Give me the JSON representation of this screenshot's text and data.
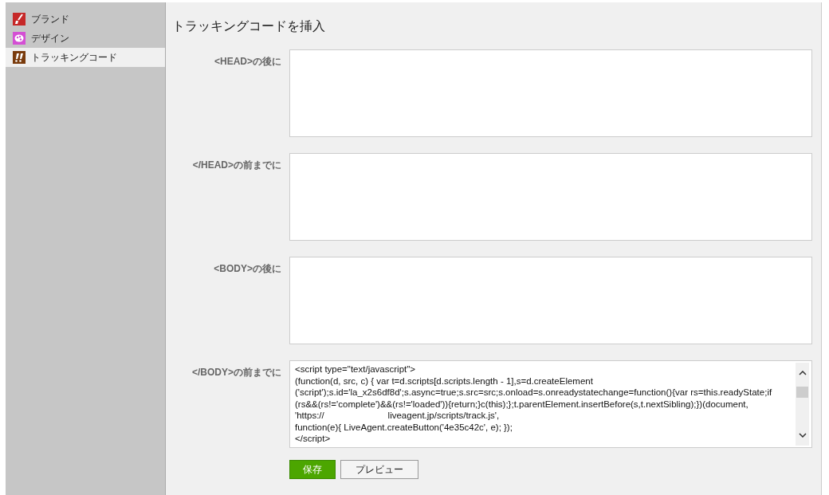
{
  "sidebar": {
    "items": [
      {
        "label": "ブランド",
        "kind": "brand",
        "selected": false
      },
      {
        "label": "デザイン",
        "kind": "design",
        "selected": false
      },
      {
        "label": "トラッキングコード",
        "kind": "tracking",
        "selected": true
      }
    ]
  },
  "main": {
    "title": "トラッキングコードを挿入",
    "fields": [
      {
        "label": "<HEAD>の後に"
      },
      {
        "label": "</HEAD>の前までに"
      },
      {
        "label": "<BODY>の後に"
      },
      {
        "label": "</BODY>の前までに",
        "value": "<script type=\"text/javascript\">\n(function(d, src, c) { var t=d.scripts[d.scripts.length - 1],s=d.createElement\n('script');s.id='la_x2s6df8d';s.async=true;s.src=src;s.onload=s.onreadystatechange=function(){var rs=this.readyState;if\n(rs&&(rs!='complete')&&(rs!='loaded')){return;}c(this);};t.parentElement.insertBefore(s,t.nextSibling);})(document,\n'https://                         liveagent.jp/scripts/track.js',\nfunction(e){ LiveAgent.createButton('4e35c42c', e); });\n</script>"
      }
    ],
    "buttons": [
      {
        "label": "保存",
        "kind": "primary"
      },
      {
        "label": "プレビュー",
        "kind": "secondary"
      }
    ]
  }
}
